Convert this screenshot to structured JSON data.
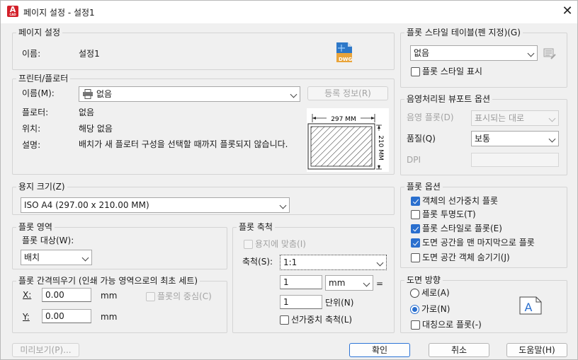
{
  "window": {
    "title": "페이지 설정 - 설정1",
    "app_icon": "A",
    "app_icon_sub": "CAD"
  },
  "page_setup": {
    "group_title": "페이지 설정",
    "name_label": "이름:",
    "name_value": "설정1",
    "dwg_icon_text": "DWG"
  },
  "printer": {
    "group_title": "프린터/플로터",
    "name_label": "이름(M):",
    "name_value": "없음",
    "properties_button": "등록 정보(R)",
    "plotter_label": "플로터:",
    "plotter_value": "없음",
    "location_label": "위치:",
    "location_value": "해당 없음",
    "description_label": "설명:",
    "description_value": "배치가 새 플로터 구성을 선택할 때까지 플롯되지 않습니다.",
    "preview_width_text": "297 MM",
    "preview_height_text": "210 MM"
  },
  "paper_size": {
    "group_title": "용지 크기(Z)",
    "value": "ISO A4 (297.00 x 210.00 MM)"
  },
  "plot_area": {
    "group_title": "플롯 영역",
    "what_label": "플롯 대상(W):",
    "what_value": "배치"
  },
  "plot_offset": {
    "group_title": "플롯 간격띄우기 (인쇄 가능 영역으로의 최초 세트)",
    "x_label": "X:",
    "x_value": "0.00",
    "x_unit": "mm",
    "y_label": "Y:",
    "y_value": "0.00",
    "y_unit": "mm",
    "center_label": "플롯의 중심(C)"
  },
  "plot_scale": {
    "group_title": "플롯 축척",
    "fit_label": "용지에 맞춤(I)",
    "scale_label": "축척(S):",
    "scale_value": "1:1",
    "value1": "1",
    "unit_value": "mm",
    "equals": "=",
    "value2": "1",
    "units_label": "단위(N)",
    "lineweights_label": "선가중치 축척(L)"
  },
  "plot_style": {
    "group_title": "플롯 스타일 테이블(펜 지정)(G)",
    "value": "없음",
    "display_label": "플롯 스타일 표시"
  },
  "shaded": {
    "group_title": "음영처리된 뷰포트 옵션",
    "shade_label": "음영 플롯(D)",
    "shade_value": "표시되는 대로",
    "quality_label": "품질(Q)",
    "quality_value": "보통",
    "dpi_label": "DPI"
  },
  "plot_options": {
    "group_title": "플롯 옵션",
    "items": [
      {
        "label": "객체의 선가중치 플롯",
        "checked": true
      },
      {
        "label": "플롯 투명도(T)",
        "checked": false
      },
      {
        "label": "플롯 스타일로 플롯(E)",
        "checked": true
      },
      {
        "label": "도면 공간을 맨 마지막으로 플롯",
        "checked": true
      },
      {
        "label": "도면 공간 객체 숨기기(J)",
        "checked": false
      }
    ]
  },
  "orientation": {
    "group_title": "도면 방향",
    "portrait_label": "세로(A)",
    "landscape_label": "가로(N)",
    "upside_down_label": "대칭으로 플롯(-)",
    "icon_letter": "A"
  },
  "footer": {
    "preview": "미리보기(P)...",
    "ok": "확인",
    "cancel": "취소",
    "help": "도움말(H)"
  },
  "colors": {
    "accent": "#2a6fce",
    "app_icon": "#d3202a"
  }
}
